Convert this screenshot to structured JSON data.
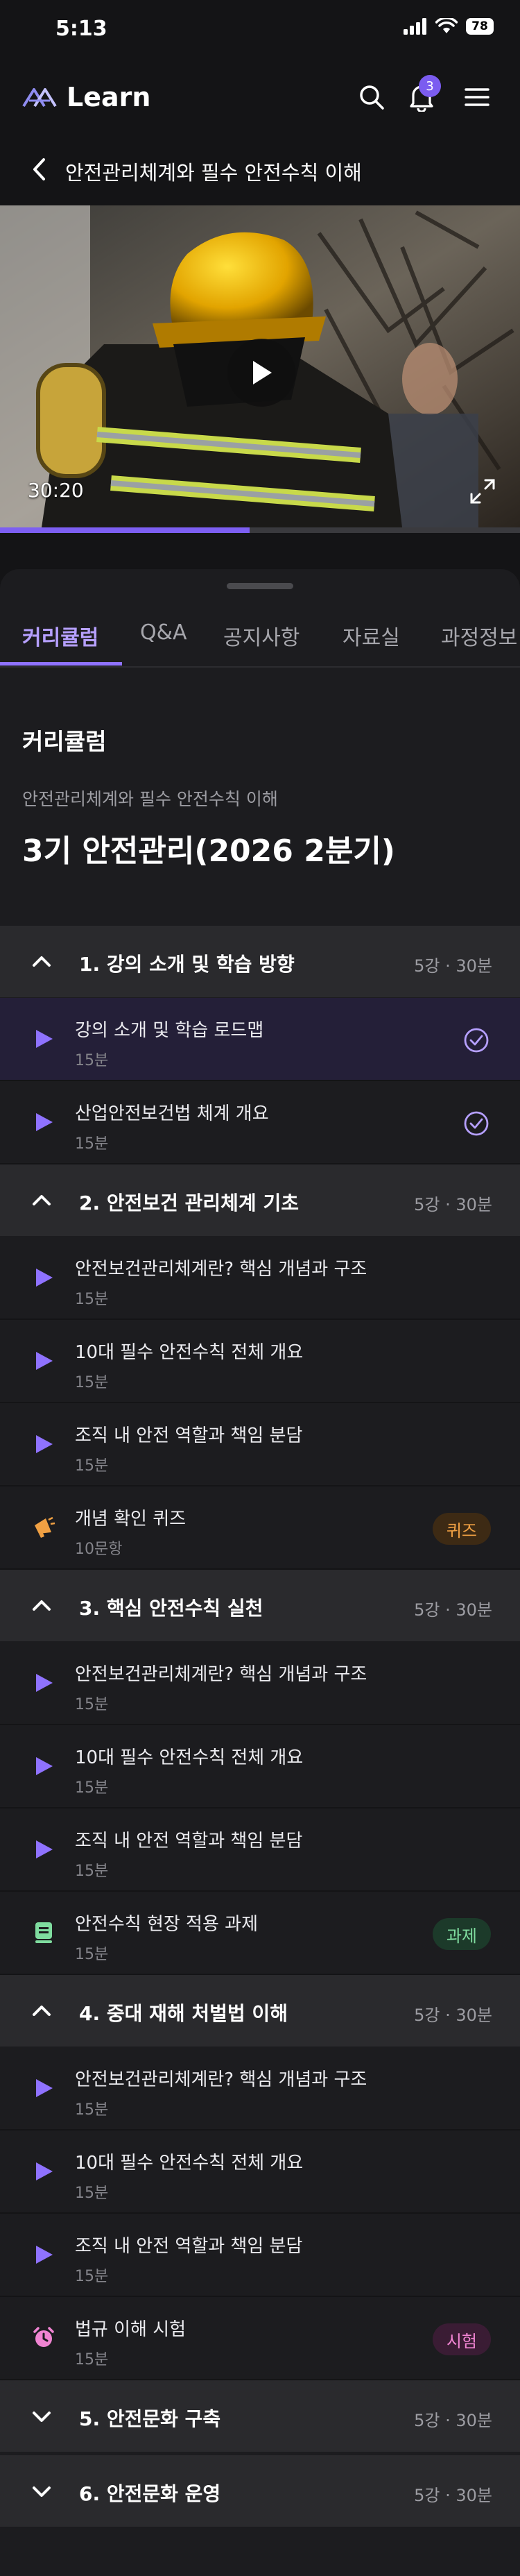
{
  "status": {
    "time": "5:13",
    "battery": "78"
  },
  "app": {
    "name": "Learn",
    "notifications": "3"
  },
  "subheader": {
    "title": "안전관리체계와 필수 안전수칙 이해"
  },
  "video": {
    "time": "30:20",
    "progress": 0.48
  },
  "tabs": [
    {
      "label": "커리큘럼",
      "active": true
    },
    {
      "label": "Q&A"
    },
    {
      "label": "공지사항"
    },
    {
      "label": "자료실"
    },
    {
      "label": "과정정보"
    }
  ],
  "curriculum": {
    "heading": "커리큘럼",
    "subtitle": "안전관리체계와 필수 안전수칙 이해",
    "title": "3기 안전관리(2026 2분기)"
  },
  "sections": [
    {
      "title": "1. 강의 소개 및 학습 방향",
      "meta": "5강 · 30분",
      "open": true,
      "items": [
        {
          "title": "강의 소개 및 학습 로드맵",
          "duration": "15분",
          "kind": "video",
          "done": true,
          "selected": true
        },
        {
          "title": "산업안전보건법 체계 개요",
          "duration": "15분",
          "kind": "video",
          "done": true
        }
      ]
    },
    {
      "title": "2. 안전보건 관리체계 기초",
      "meta": "5강 · 30분",
      "open": true,
      "items": [
        {
          "title": "안전보건관리체계란? 핵심 개념과 구조",
          "duration": "15분",
          "kind": "video"
        },
        {
          "title": "10대 필수 안전수칙 전체 개요",
          "duration": "15분",
          "kind": "video"
        },
        {
          "title": "조직 내 안전 역할과 책임 분담",
          "duration": "15분",
          "kind": "video"
        },
        {
          "title": "개념 확인 퀴즈",
          "duration": "10문항",
          "kind": "quiz",
          "tag": "퀴즈"
        }
      ]
    },
    {
      "title": "3. 핵심 안전수칙 실천",
      "meta": "5강 · 30분",
      "open": true,
      "items": [
        {
          "title": "안전보건관리체계란? 핵심 개념과 구조",
          "duration": "15분",
          "kind": "video"
        },
        {
          "title": "10대 필수 안전수칙 전체 개요",
          "duration": "15분",
          "kind": "video"
        },
        {
          "title": "조직 내 안전 역할과 책임 분담",
          "duration": "15분",
          "kind": "video"
        },
        {
          "title": "안전수칙 현장 적용 과제",
          "duration": "15분",
          "kind": "task",
          "tag": "과제"
        }
      ]
    },
    {
      "title": "4. 중대 재해 처벌법 이해",
      "meta": "5강 · 30분",
      "open": true,
      "items": [
        {
          "title": "안전보건관리체계란? 핵심 개념과 구조",
          "duration": "15분",
          "kind": "video"
        },
        {
          "title": "10대 필수 안전수칙 전체 개요",
          "duration": "15분",
          "kind": "video"
        },
        {
          "title": "조직 내 안전 역할과 책임 분담",
          "duration": "15분",
          "kind": "video"
        },
        {
          "title": "법규 이해 시험",
          "duration": "15분",
          "kind": "exam",
          "tag": "시험"
        }
      ]
    },
    {
      "title": "5. 안전문화 구축",
      "meta": "5강 · 30분",
      "open": false,
      "items": []
    },
    {
      "title": "6. 안전문화 운영",
      "meta": "5강 · 30분",
      "open": false,
      "items": []
    }
  ],
  "colors": {
    "accent": "#8f72ff",
    "quiz": "#f0a043",
    "task": "#7fdc9f",
    "exam": "#f084d2"
  }
}
